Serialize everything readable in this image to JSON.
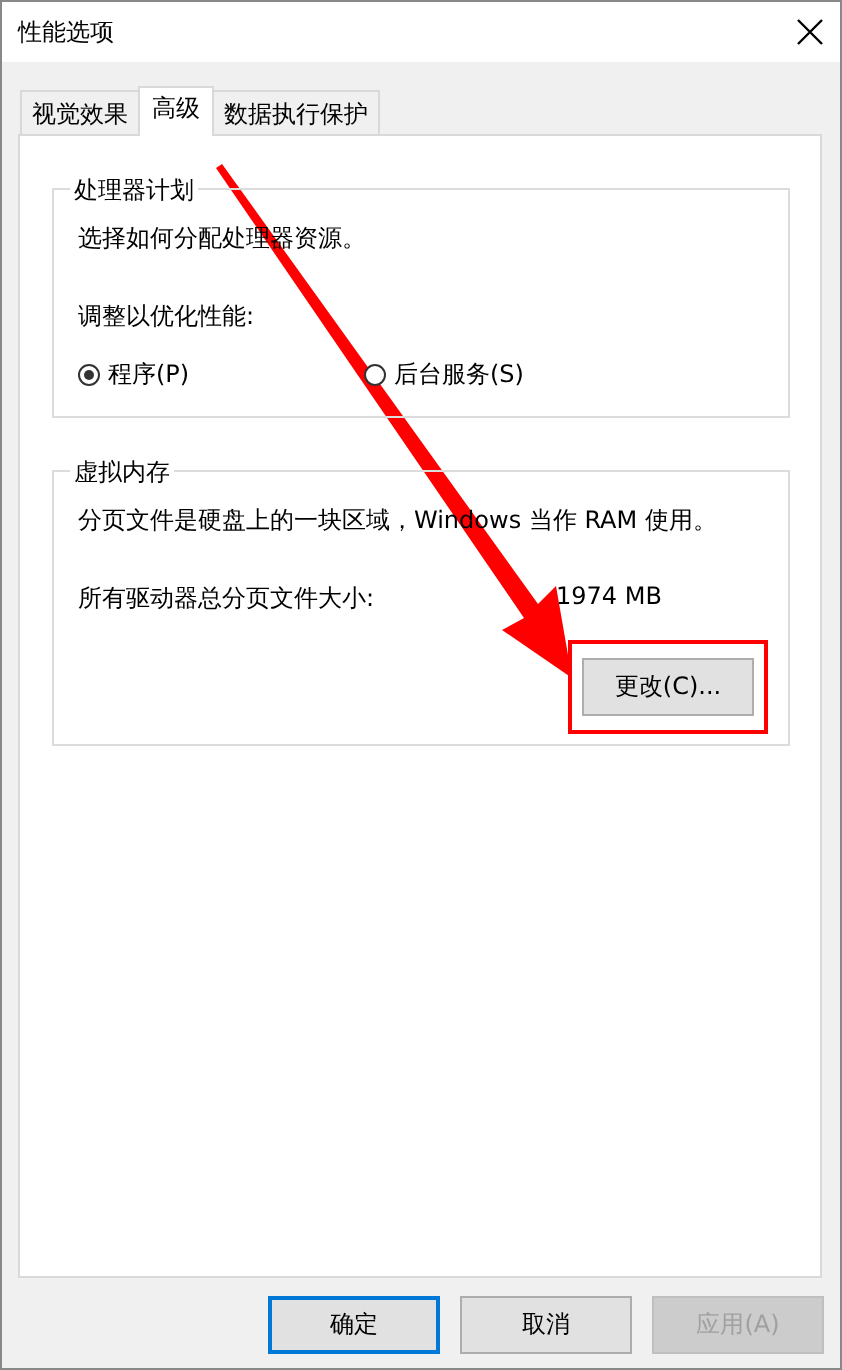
{
  "window": {
    "title": "性能选项"
  },
  "tabs": [
    {
      "label": "视觉效果",
      "selected": false
    },
    {
      "label": "高级",
      "selected": true
    },
    {
      "label": "数据执行保护",
      "selected": false
    }
  ],
  "processor_group": {
    "title": "处理器计划",
    "description": "选择如何分配处理器资源。",
    "prompt": "调整以优化性能:",
    "options": [
      {
        "label": "程序(P)",
        "selected": true
      },
      {
        "label": "后台服务(S)",
        "selected": false
      }
    ]
  },
  "memory_group": {
    "title": "虚拟内存",
    "description": "分页文件是硬盘上的一块区域，Windows 当作 RAM 使用。",
    "size_label": "所有驱动器总分页文件大小:",
    "size_value": "1974 MB",
    "change_button": {
      "label": "更改(C)...",
      "highlighted": true
    }
  },
  "buttons": [
    {
      "label": "确定",
      "default": true,
      "disabled": false
    },
    {
      "label": "取消",
      "default": false,
      "disabled": false
    },
    {
      "label": "应用(A)",
      "default": false,
      "disabled": true
    }
  ]
}
